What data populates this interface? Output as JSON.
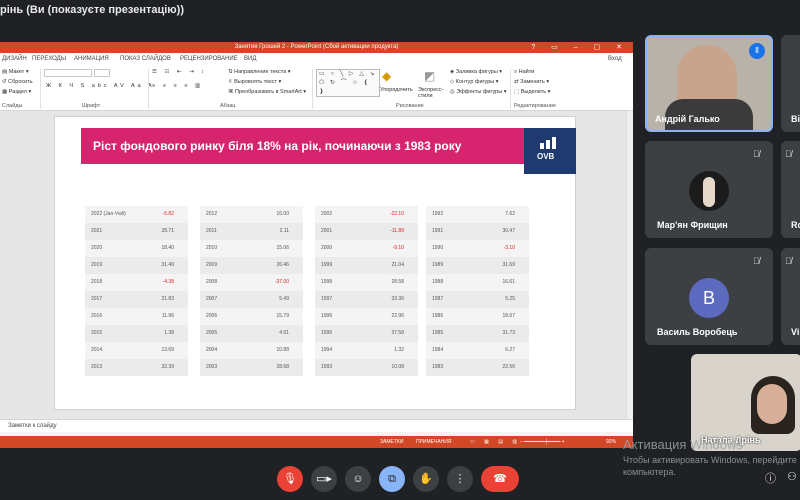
{
  "meeting": {
    "title_bar": "рінь (Ви (показуєте презентацію))"
  },
  "powerpoint": {
    "window_title": "Занятия Грошей 2  -  PowerPoint (Сбой активации продукта)",
    "sign_in": "Вход",
    "tabs": [
      "ДИЗАЙН",
      "ПЕРЕХОДЫ",
      "АНИМАЦИЯ",
      "ПОКАЗ СЛАЙДОВ",
      "РЕЦЕНЗИРОВАНИЕ",
      "ВИД"
    ],
    "ribbon": {
      "maket": "Макет",
      "sbrosit": "Сбросить",
      "razdel": "Раздел",
      "group_slides": "Слайды",
      "group_font": "Шрифт",
      "group_paragraph": "Абзац",
      "group_drawing": "Рисование",
      "group_editing": "Редактирование",
      "text_direction": "Направление текста",
      "align_text": "Выровнять текст",
      "smartart": "Преобразовать в SmartArt",
      "arrange": "Упорядочить",
      "quick_styles": "Экспресс-стили",
      "shape_fill": "Заливка фигуры",
      "shape_outline": "Контур фигуры",
      "shape_effects": "Эффекты фигуры",
      "find": "Найти",
      "replace": "Заменить",
      "select": "Выделить"
    },
    "slide": {
      "title": "Ріст фондового ринку біля 18%  на рік, починаючи з 1983 року",
      "logo_text": "OVB",
      "tables": [
        [
          {
            "year": "2022",
            "note": "(Jan-Vwli)",
            "value": "-5.82",
            "neg": true
          },
          {
            "year": "2021",
            "value": "28.71"
          },
          {
            "year": "2020",
            "value": "18.40"
          },
          {
            "year": "2019",
            "value": "31.49"
          },
          {
            "year": "2018",
            "value": "-4.38",
            "neg": true
          },
          {
            "year": "2017",
            "value": "21.83"
          },
          {
            "year": "2016",
            "value": "11.96"
          },
          {
            "year": "2015",
            "value": "1.38"
          },
          {
            "year": "2014",
            "value": "13.69"
          },
          {
            "year": "2013",
            "value": "32.39"
          }
        ],
        [
          {
            "year": "2012",
            "value": "16.00"
          },
          {
            "year": "2011",
            "value": "2.11"
          },
          {
            "year": "2010",
            "value": "15.06"
          },
          {
            "year": "2009",
            "value": "26.46"
          },
          {
            "year": "2008",
            "value": "-37.00",
            "neg": true
          },
          {
            "year": "2007",
            "value": "5.49"
          },
          {
            "year": "2006",
            "value": "15.79"
          },
          {
            "year": "2005",
            "value": "4.91"
          },
          {
            "year": "2004",
            "value": "10.88"
          },
          {
            "year": "2003",
            "value": "28.68"
          }
        ],
        [
          {
            "year": "2002",
            "value": "-22.10",
            "neg": true
          },
          {
            "year": "2001",
            "value": "-11.89",
            "neg": true
          },
          {
            "year": "2000",
            "value": "-9.10",
            "neg": true
          },
          {
            "year": "1999",
            "value": "21.04"
          },
          {
            "year": "1998",
            "value": "28.58"
          },
          {
            "year": "1997",
            "value": "33.36"
          },
          {
            "year": "1996",
            "value": "22.96"
          },
          {
            "year": "1995",
            "value": "37.58"
          },
          {
            "year": "1994",
            "value": "1.32"
          },
          {
            "year": "1993",
            "value": "10.08"
          }
        ],
        [
          {
            "year": "1992",
            "value": "7.62"
          },
          {
            "year": "1991",
            "value": "30.47"
          },
          {
            "year": "1990",
            "value": "-3.10",
            "neg": true
          },
          {
            "year": "1989",
            "value": "31.69"
          },
          {
            "year": "1988",
            "value": "16.61"
          },
          {
            "year": "1987",
            "value": "5.25"
          },
          {
            "year": "1986",
            "value": "18.67"
          },
          {
            "year": "1985",
            "value": "31.73"
          },
          {
            "year": "1984",
            "value": "6.27"
          },
          {
            "year": "1983",
            "value": "22.56"
          }
        ]
      ]
    },
    "notes_label": "Заметки к слайду",
    "status": {
      "notes": "ЗАМЕТКИ",
      "comments": "ПРИМЕЧАНИЯ",
      "zoom": "92%"
    }
  },
  "participants": [
    {
      "name": "Андрій Галько",
      "speaking": true
    },
    {
      "name": "Ві"
    },
    {
      "name": "Мар'ян Фрищин",
      "mic_off": true
    },
    {
      "name": "Ro",
      "mic_off": true
    },
    {
      "name": "Василь Воробець",
      "initial": "B",
      "mic_off": true
    },
    {
      "name": "Vi",
      "mic_off": true
    },
    {
      "name": "Натала Дрінь"
    }
  ],
  "windows_activation": {
    "title": "Активация Windows",
    "line2": "Чтобы активировать Windows, перейдите",
    "line3": "компьютера."
  },
  "controls": {
    "mic": "mic-off",
    "camera": "camera",
    "emoji": "emoji",
    "present": "present",
    "hand": "raise-hand",
    "more": "more",
    "end": "end-call"
  },
  "colors": {
    "banner": "#d7246f",
    "ppt_accent": "#d24726",
    "logo": "#1e3a6e",
    "end_call": "#ea4335",
    "present_active": "#8ab4f8",
    "avatar_v": "#5c6bc0"
  }
}
